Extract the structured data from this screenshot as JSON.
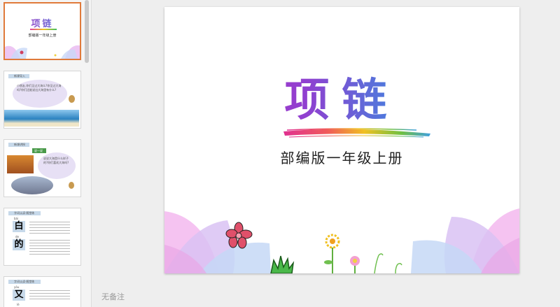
{
  "slides_panel": {
    "thumbnails": [
      {
        "number": 1,
        "title": "项链",
        "subtitle": "部编版一年级上册"
      },
      {
        "number": 2,
        "header": "新课导入",
        "text": "小朋友,你们见过大海么?你见过大海吗?你们还能说出大海里有什么?"
      },
      {
        "number": 3,
        "header": "新课讲授",
        "tag": "说一说",
        "text": "说说大海是什么样子的?你们喜欢大海吗?"
      },
      {
        "number": 4,
        "header": "字词认读·随堂练",
        "chars": [
          {
            "pinyin": "bái",
            "char": "白"
          },
          {
            "pinyin": "de",
            "char": "的"
          }
        ]
      },
      {
        "number": 5,
        "header": "字词认读·随堂练",
        "chars": [
          {
            "pinyin": "yòu",
            "char": "又"
          },
          {
            "pinyin": "lè",
            "char": ""
          }
        ]
      }
    ]
  },
  "slide": {
    "title": "项链",
    "subtitle": "部编版一年级上册"
  },
  "notes": {
    "placeholder": "无备注"
  },
  "colors": {
    "selected_border": "#e07a3a",
    "title_gradient_start": "#c030c0",
    "title_gradient_end": "#40a0f0"
  }
}
